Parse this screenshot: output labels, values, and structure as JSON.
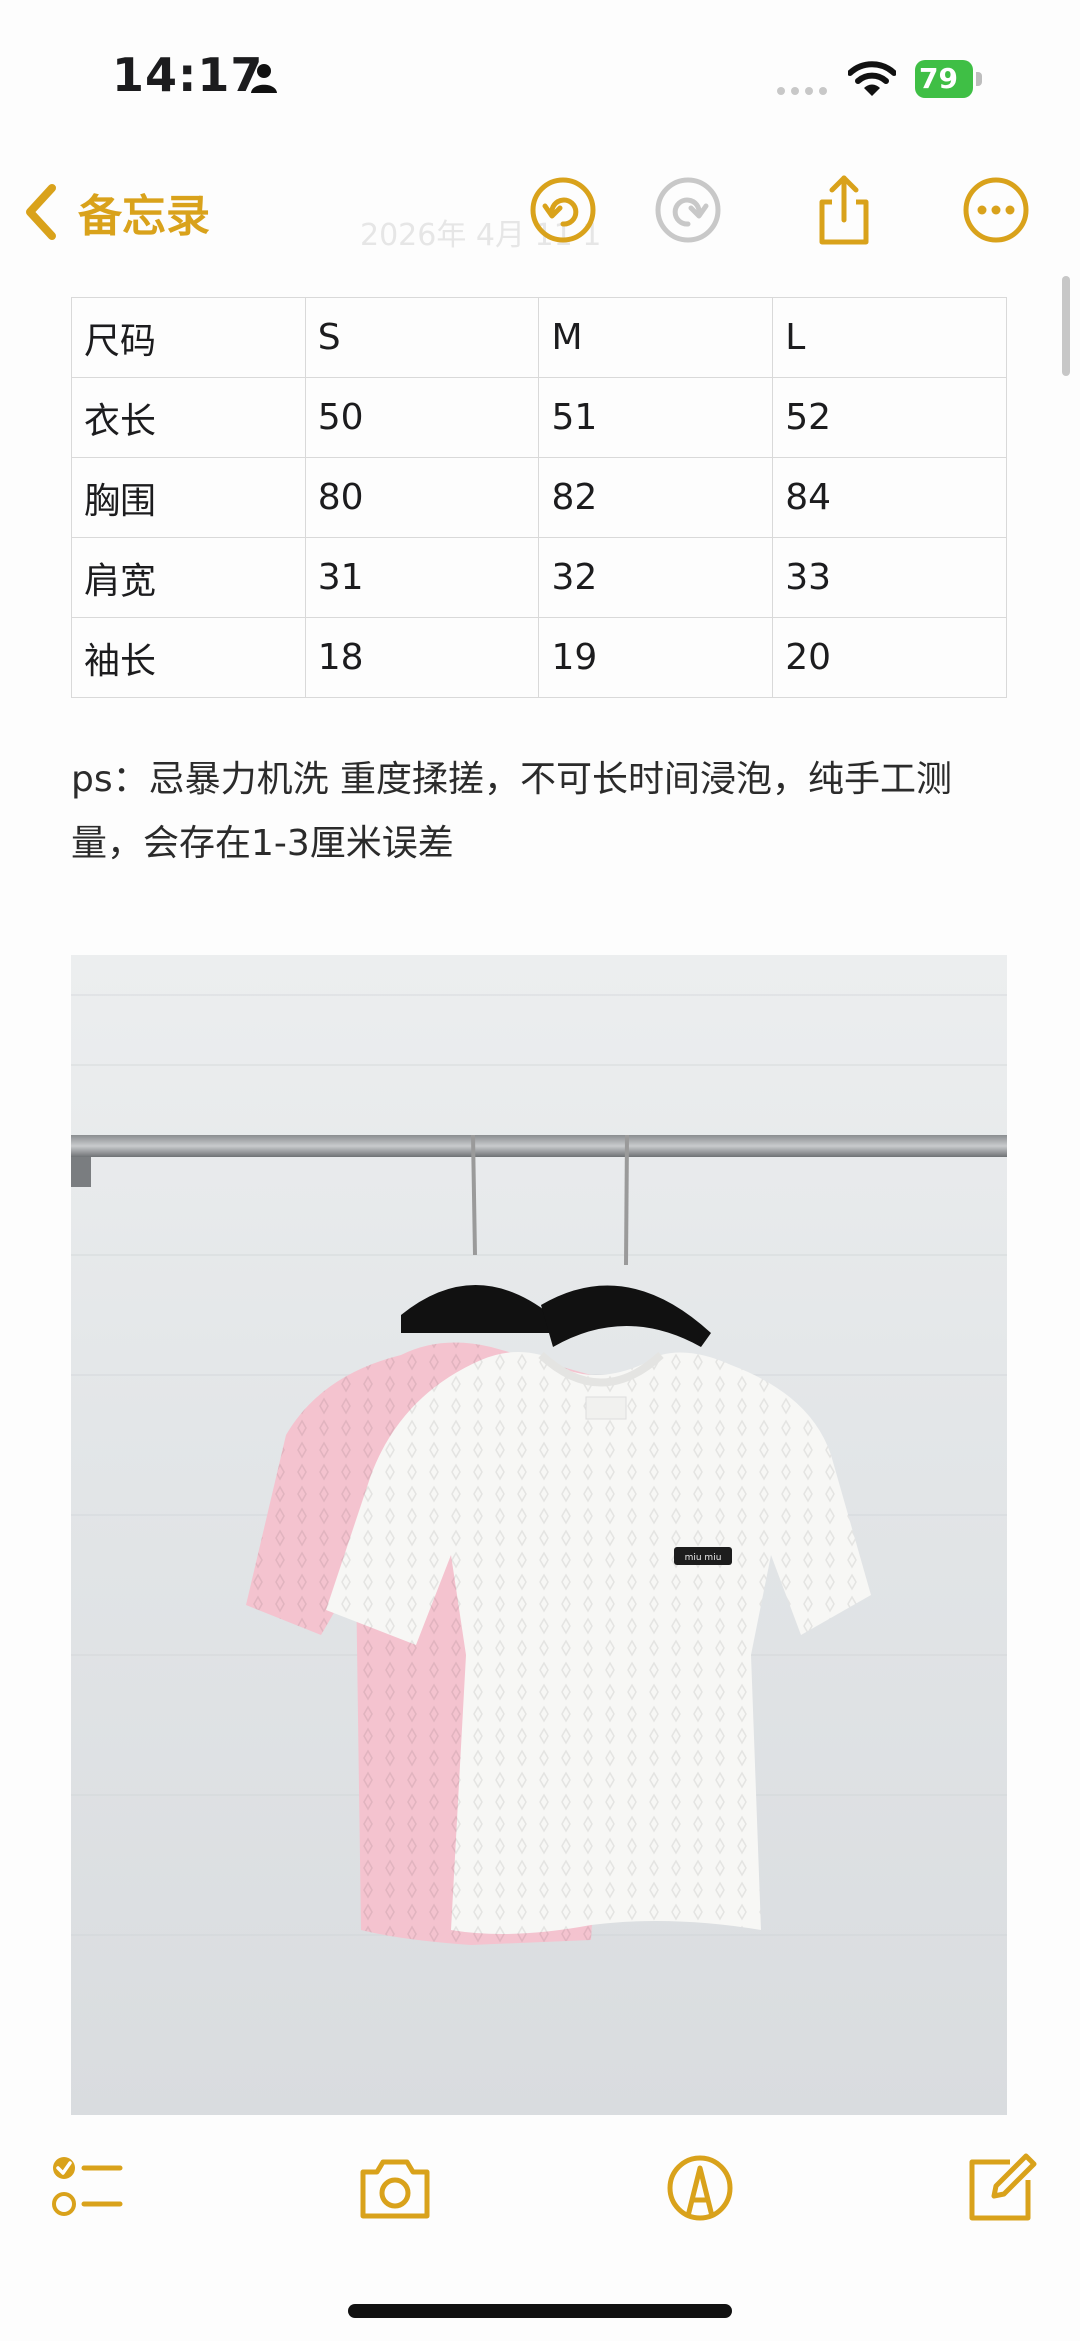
{
  "status_bar": {
    "time": "14:17",
    "battery": "79"
  },
  "nav": {
    "back_label": "备忘录",
    "faded_header": "2026年 4月 11 1"
  },
  "table": {
    "rows": [
      [
        "尺码",
        "S",
        "M",
        "L"
      ],
      [
        "衣长",
        "50",
        "51",
        "52"
      ],
      [
        "胸围",
        "80",
        "82",
        "84"
      ],
      [
        "肩宽",
        "31",
        "32",
        "33"
      ],
      [
        "袖长",
        "18",
        "19",
        "20"
      ]
    ]
  },
  "note": {
    "text": "ps：忌暴力机洗 重度揉搓，不可长时间浸泡，纯手工测量，会存在1-3厘米误差"
  },
  "photo": {
    "brand_label": "miu miu"
  },
  "colors": {
    "accent": "#d9a21b",
    "battery": "#3fbf45",
    "pink_shirt": "#f4c3cf",
    "white_shirt": "#f7f7f5"
  }
}
